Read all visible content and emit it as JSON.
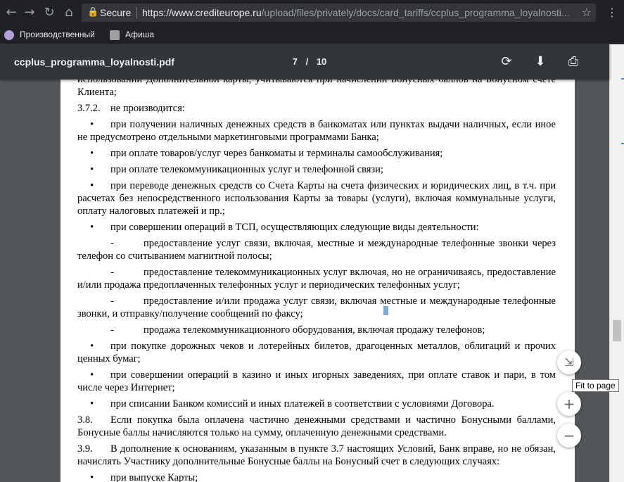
{
  "browser": {
    "secure_label": "Secure",
    "url_host": "https://www.crediteurope.ru",
    "url_path": "/upload/files/privately/docs/card_tariffs/ccplus_programma_loyalnosti...",
    "bookmarks": [
      {
        "label": "Производственный",
        "color": "#b39ddb"
      },
      {
        "label": "Афиша",
        "color": "#9e9e9e"
      }
    ]
  },
  "pdf": {
    "filename": "ccplus_programma_loyalnosti.pdf",
    "current_page": "7",
    "total_pages": "10",
    "page_separator": "/"
  },
  "doc": {
    "l1": "использовании Дополнительной карты, учитываются при начислении Бонусных баллов на Бонусном счете Клиента;",
    "s372_num": "3.7.2.",
    "s372_text": "не производится:",
    "b1": "при получении наличных денежных средств в банкоматах или пунктах выдачи наличных, если иное не предусмотрено отдельными маркетинговыми программами Банка;",
    "b2": "при оплате товаров/услуг через банкоматы и терминалы самообслуживания;",
    "b3": "при оплате телекоммуникационных услуг и телефонной связи;",
    "b4": "при переводе денежных средств со Счета Карты на счета физических и юридических лиц, в т.ч. при расчетах без непосредственного использования Карты за товары (услуги), включая коммунальные услуги, оплату налоговых платежей и пр.;",
    "b5": "при совершении операций в ТСП, осуществляющих следующие виды деятельности:",
    "d1": "предоставление услуг связи, включая, местные и международные телефонные звонки через телефон со считыванием магнитной полосы;",
    "d2": "предоставление телекоммуникационных услуг включая, но не ограничиваясь, предоставление и/или продажа предоплаченных телефонных услуг и периодических телефонных услуг;",
    "d3": "предоставление и/или продажа услуг связи, включая местные и международные телефонные звонки, и отправку/получение сообщений по факсу;",
    "d4": "продажа телекоммуникационного оборудования, включая продажу телефонов;",
    "b6": "при покупке дорожных чеков и лотерейных билетов, драгоценных металлов, облигаций и прочих ценных бумаг;",
    "b7": "при совершении операций в казино и иных игорных заведениях, при оплате ставок и пари, в том числе через Интернет;",
    "b8": "при списании Банком комиссий и иных платежей в соответствии с условиями Договора.",
    "s38_num": "3.8.",
    "s38_text": "Если покупка была оплачена частично денежными средствами и частично Бонусными баллами, Бонусные баллы начисляются только на сумму, оплаченную денежными средствами.",
    "s39_num": "3.9.",
    "s39_text": "В дополнение к основаниям, указанным в пункте 3.7 настоящих Условий, Банк вправе, но не обязан, начислять Участнику дополнительные Бонусные баллы на Бонусный счет в следующих случаях:",
    "b9": "при выпуске Карты;",
    "dash": "-"
  },
  "zoom": {
    "fit_tooltip": "Fit to page"
  }
}
